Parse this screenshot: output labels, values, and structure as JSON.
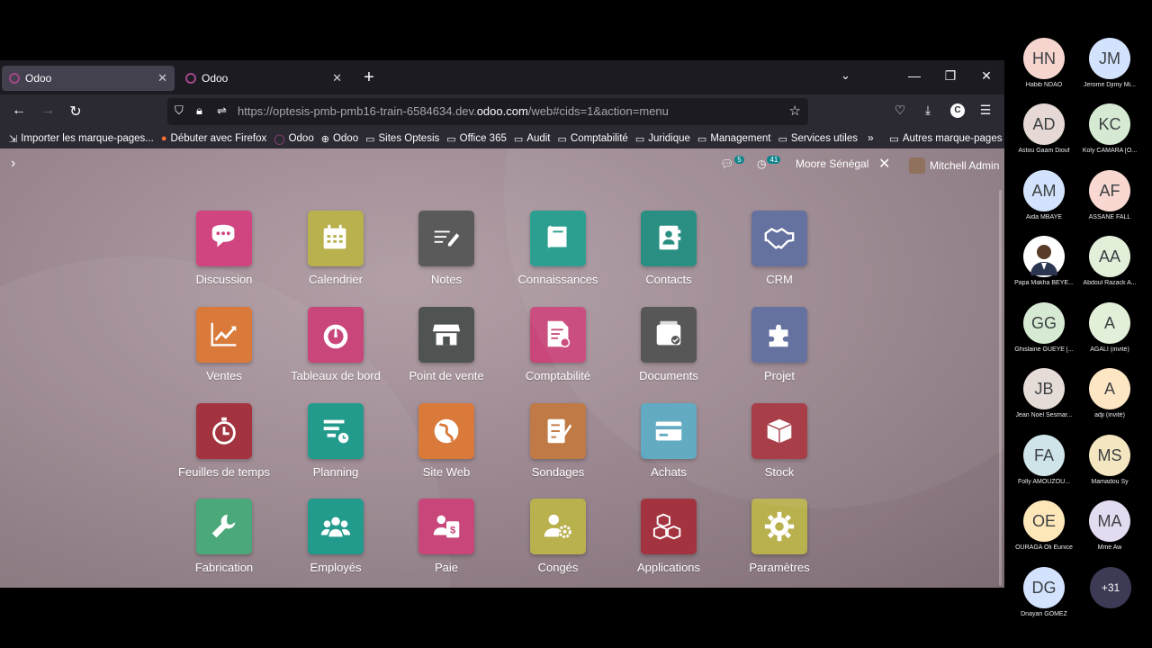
{
  "browser": {
    "tabs": [
      {
        "label": "Odoo",
        "active": true
      },
      {
        "label": "Odoo",
        "active": false
      }
    ],
    "url_prefix": "https://optesis-pmb-pmb16-train-6584634.dev.",
    "url_domain": "odoo.com",
    "url_suffix": "/web#cids=1&action=menu",
    "profile_letter": "C",
    "bookmarks": [
      {
        "label": "Importer les marque-pages...",
        "icon": "import-icon"
      },
      {
        "label": "Débuter avec Firefox",
        "icon": "firefox-icon"
      },
      {
        "label": "Odoo",
        "icon": "odoo-icon"
      },
      {
        "label": "Odoo",
        "icon": "globe-icon"
      },
      {
        "label": "Sites Optesis",
        "icon": "folder-icon"
      },
      {
        "label": "Office 365",
        "icon": "folder-icon"
      },
      {
        "label": "Audit",
        "icon": "folder-icon"
      },
      {
        "label": "Comptabilité",
        "icon": "folder-icon"
      },
      {
        "label": "Juridique",
        "icon": "folder-icon"
      },
      {
        "label": "Management",
        "icon": "folder-icon"
      },
      {
        "label": "Services utiles",
        "icon": "folder-icon"
      }
    ],
    "other_bookmarks": "Autres marque-pages"
  },
  "odoo": {
    "chat_count": "5",
    "activity_count": "41",
    "company": "Moore Sénégal",
    "user": "Mitchell Admin",
    "apps": [
      {
        "label": "Discussion",
        "icon": "chat-icon",
        "color": "#d0457f"
      },
      {
        "label": "Calendrier",
        "icon": "calendar-icon",
        "color": "#b9b04e"
      },
      {
        "label": "Notes",
        "icon": "notes-icon",
        "color": "#5a5a5a"
      },
      {
        "label": "Connaissances",
        "icon": "book-icon",
        "color": "#229a8c"
      },
      {
        "label": "Contacts",
        "icon": "contact-book-icon",
        "color": "#1f8a7c"
      },
      {
        "label": "CRM",
        "icon": "handshake-icon",
        "color": "#5d6a9a"
      },
      {
        "label": "Ventes",
        "icon": "chart-up-icon",
        "color": "#d97a3a"
      },
      {
        "label": "Tableaux de bord",
        "icon": "gauge-icon",
        "color": "#c8467a"
      },
      {
        "label": "Point de vente",
        "icon": "shop-icon",
        "color": "#4f5452"
      },
      {
        "label": "Comptabilité",
        "icon": "invoice-icon",
        "color": "#c8467a"
      },
      {
        "label": "Documents",
        "icon": "inbox-icon",
        "color": "#4f4f4f"
      },
      {
        "label": "Projet",
        "icon": "puzzle-icon",
        "color": "#5d6a9a"
      },
      {
        "label": "Feuilles de temps",
        "icon": "stopwatch-icon",
        "color": "#a3343f"
      },
      {
        "label": "Planning",
        "icon": "planning-icon",
        "color": "#229a8c"
      },
      {
        "label": "Site Web",
        "icon": "globe-icon",
        "color": "#d97a3a"
      },
      {
        "label": "Sondages",
        "icon": "survey-icon",
        "color": "#c07a45"
      },
      {
        "label": "Achats",
        "icon": "card-icon",
        "color": "#5aa7c0"
      },
      {
        "label": "Stock",
        "icon": "box-icon",
        "color": "#a3343f"
      },
      {
        "label": "Fabrication",
        "icon": "wrench-icon",
        "color": "#4aa87a"
      },
      {
        "label": "Employés",
        "icon": "people-icon",
        "color": "#229a8c"
      },
      {
        "label": "Paie",
        "icon": "payslip-icon",
        "color": "#c8467a"
      },
      {
        "label": "Congés",
        "icon": "user-gear-icon",
        "color": "#b9b04e"
      },
      {
        "label": "Applications",
        "icon": "cubes-icon",
        "color": "#a3343f"
      },
      {
        "label": "Paramètres",
        "icon": "gear-icon",
        "color": "#b9b04e"
      }
    ]
  },
  "participants": [
    {
      "initials": "HN",
      "name": "Habib NDAO",
      "color": "#f6d5cf"
    },
    {
      "initials": "JM",
      "name": "Jerome Djimy Mi...",
      "color": "#d3e3fd"
    },
    {
      "initials": "AD",
      "name": "Astou Gaam Diouf",
      "color": "#e6d9d5"
    },
    {
      "initials": "KC",
      "name": "Koly CAMARA [O...",
      "color": "#d6ead3"
    },
    {
      "initials": "AM",
      "name": "Aida MBAYE",
      "color": "#d3e3fd"
    },
    {
      "initials": "AF",
      "name": "ASSANE FALL",
      "color": "#f9d8d2"
    },
    {
      "initials": "",
      "name": "Papa Makha BEYE...",
      "color": "#ffffff"
    },
    {
      "initials": "AA",
      "name": "Abdoul Razack A...",
      "color": "#e2efd9"
    },
    {
      "initials": "GG",
      "name": "Ghislaine GUEYE [...",
      "color": "#d6ead3"
    },
    {
      "initials": "A",
      "name": "AGALI (invité)",
      "color": "#e2efd9"
    },
    {
      "initials": "JB",
      "name": "Jean Noel Sesmar...",
      "color": "#e6dcd7"
    },
    {
      "initials": "A",
      "name": "adji (invité)",
      "color": "#fde6c4"
    },
    {
      "initials": "FA",
      "name": "Folly AMOUZOU...",
      "color": "#cfe4e8"
    },
    {
      "initials": "MS",
      "name": "Mamadou Sy",
      "color": "#f3e6c0"
    },
    {
      "initials": "OE",
      "name": "OURAGA Oli Eunice",
      "color": "#fde6b8"
    },
    {
      "initials": "MA",
      "name": "Mme Aw",
      "color": "#e3dbf0"
    },
    {
      "initials": "DG",
      "name": "Dnayan GOMEZ",
      "color": "#d3e3fd"
    }
  ],
  "more_participants": "+31"
}
